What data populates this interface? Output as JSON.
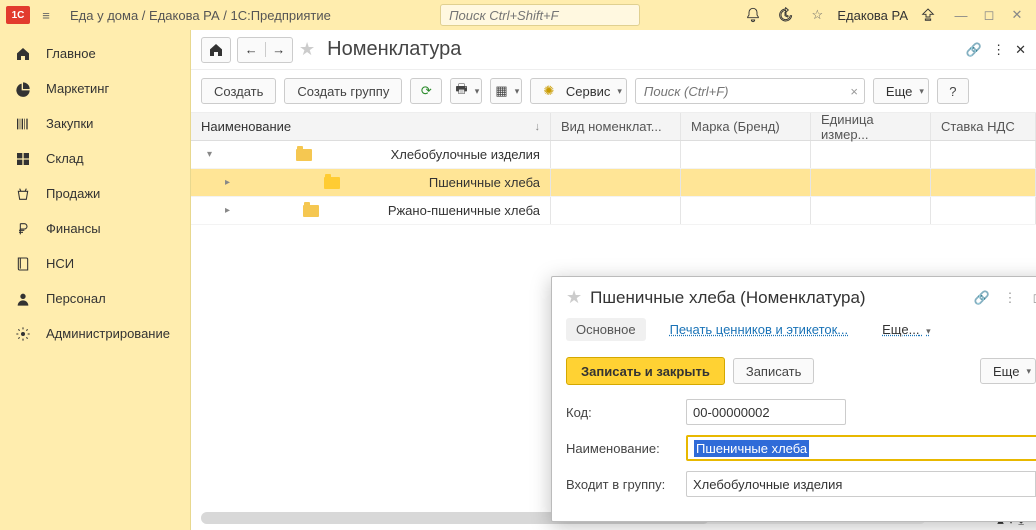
{
  "title": "Еда у дома / Едакова РА / 1С:Предприятие",
  "search_placeholder": "Поиск Ctrl+Shift+F",
  "user": "Едакова РА",
  "sidebar": [
    {
      "icon": "home",
      "label": "Главное"
    },
    {
      "icon": "pie",
      "label": "Маркетинг"
    },
    {
      "icon": "barcode",
      "label": "Закупки"
    },
    {
      "icon": "grid",
      "label": "Склад"
    },
    {
      "icon": "basket",
      "label": "Продажи"
    },
    {
      "icon": "ruble",
      "label": "Финансы"
    },
    {
      "icon": "book",
      "label": "НСИ"
    },
    {
      "icon": "person",
      "label": "Персонал"
    },
    {
      "icon": "gear",
      "label": "Администрирование"
    }
  ],
  "page": {
    "title": "Номенклатура",
    "toolbar": {
      "create": "Создать",
      "create_group": "Создать группу",
      "service": "Сервис",
      "search_placeholder": "Поиск (Ctrl+F)",
      "more": "Еще",
      "help": "?"
    },
    "columns": [
      "Наименование",
      "Вид номенклат...",
      "Марка (Бренд)",
      "Единица измер...",
      "Ставка НДС"
    ],
    "rows": [
      {
        "level": 1,
        "expanded": true,
        "label": "Хлебобулочные изделия"
      },
      {
        "level": 2,
        "expanded": false,
        "label": "Пшеничные хлеба",
        "selected": true
      },
      {
        "level": 2,
        "expanded": false,
        "label": "Ржано-пшеничные хлеба"
      }
    ]
  },
  "modal": {
    "title": "Пшеничные хлеба (Номенклатура)",
    "tabs": {
      "main": "Основное",
      "print": "Печать ценников и этикеток...",
      "more": "Еще..."
    },
    "buttons": {
      "save_close": "Записать и закрыть",
      "save": "Записать",
      "more": "Еще",
      "help": "?"
    },
    "fields": {
      "code_label": "Код:",
      "code_value": "00-00000002",
      "name_label": "Наименование:",
      "name_value": "Пшеничные хлеба",
      "group_label": "Входит в группу:",
      "group_value": "Хлебобулочные изделия"
    }
  }
}
